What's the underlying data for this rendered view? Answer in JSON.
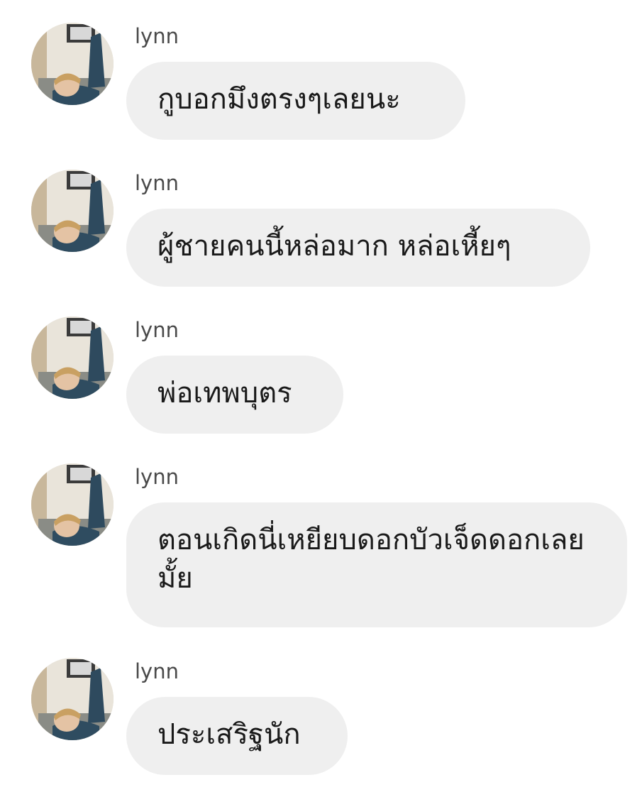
{
  "messages": [
    {
      "sender": "lynn",
      "text": "กูบอกมึงตรงๆเลยนะ"
    },
    {
      "sender": "lynn",
      "text": "ผู้ชายคนนี้หล่อมาก หล่อเหี้ยๆ"
    },
    {
      "sender": "lynn",
      "text": "พ่อเทพบุตร"
    },
    {
      "sender": "lynn",
      "text": "ตอนเกิดนี่เหยียบดอกบัวเจ็ดดอกเลยมั้ย"
    },
    {
      "sender": "lynn",
      "text": "ประเสริฐนัก"
    }
  ],
  "colors": {
    "bubble": "#efefef",
    "sender_text": "#4a4a4a",
    "message_text": "#1a1a1a"
  }
}
